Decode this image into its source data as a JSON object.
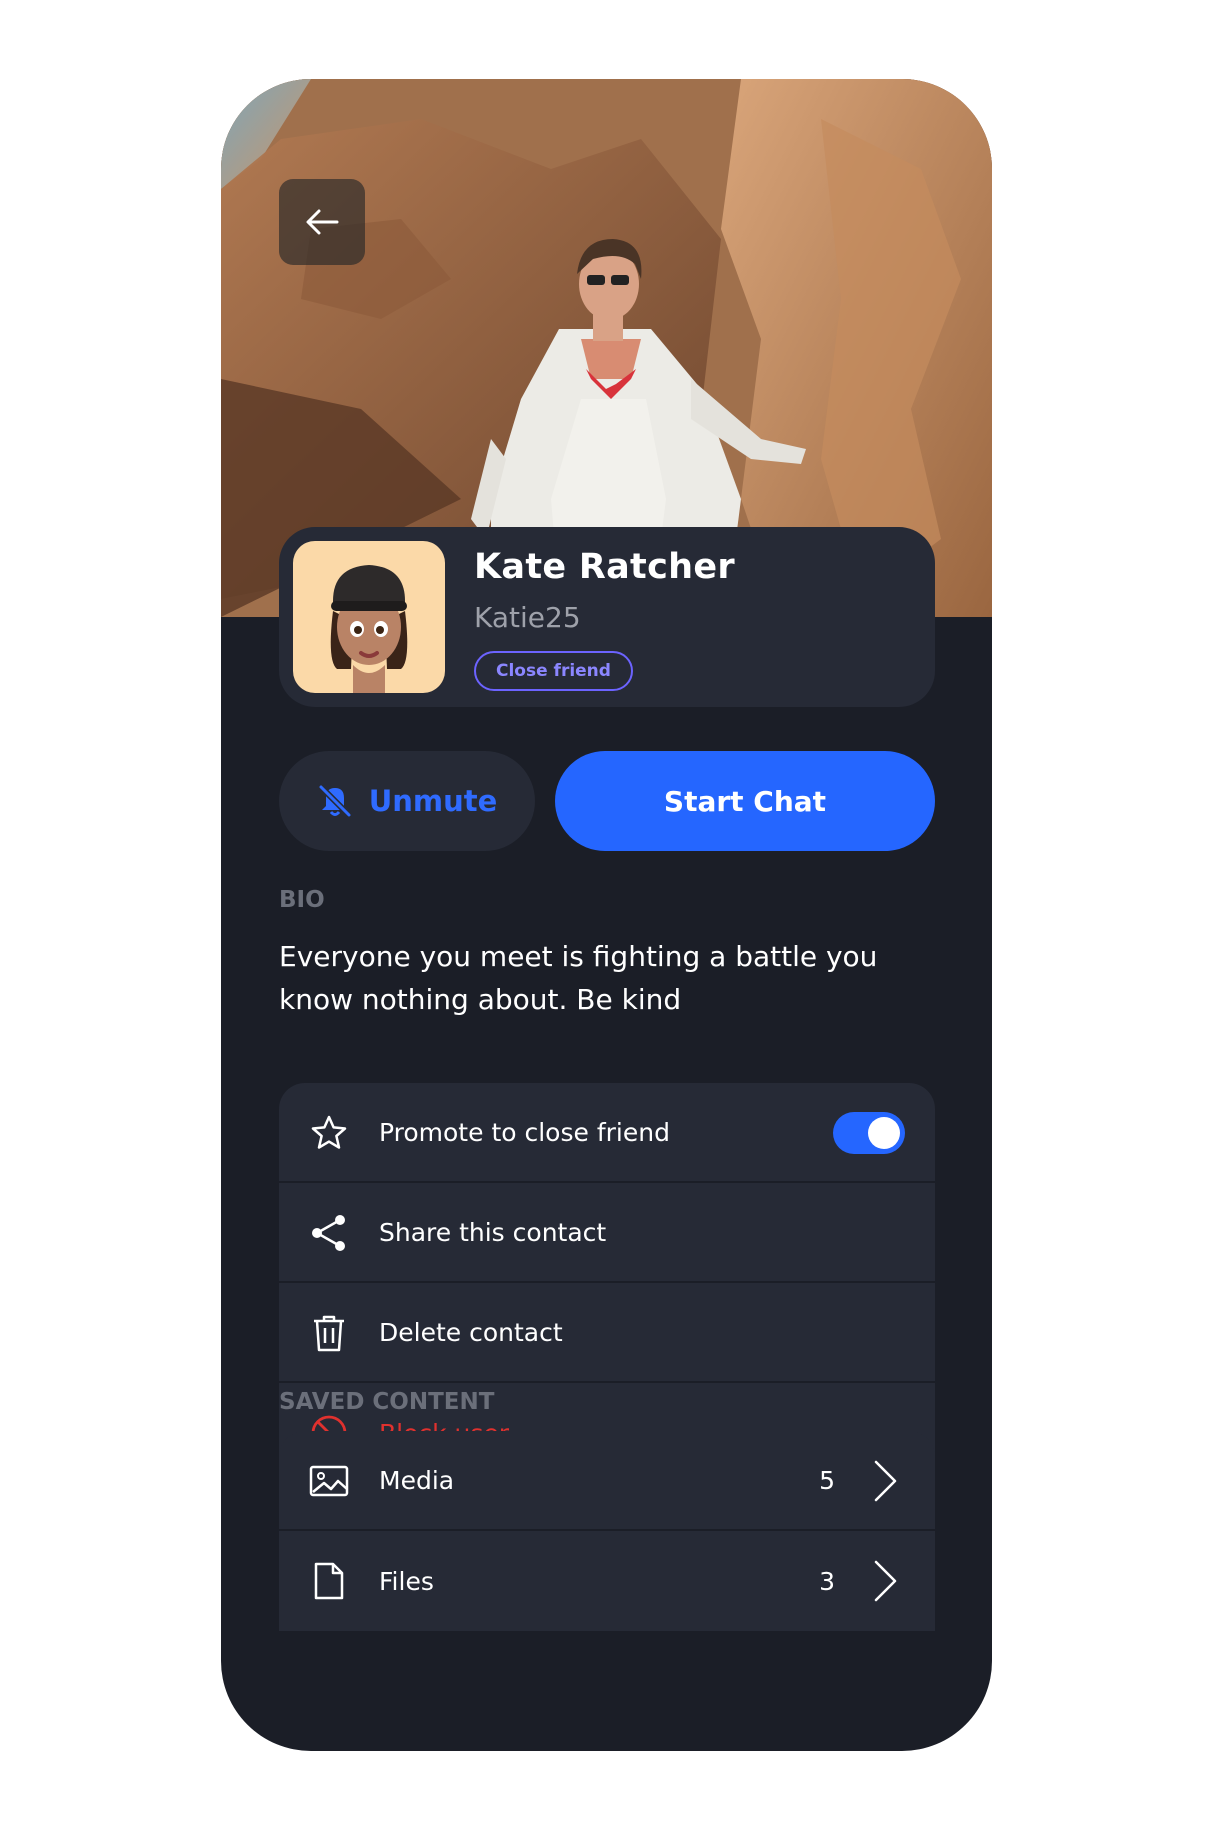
{
  "profile": {
    "name": "Kate Ratcher",
    "username": "Katie25",
    "badge": "Close friend"
  },
  "actions": {
    "unmute_label": "Unmute",
    "start_chat_label": "Start Chat"
  },
  "bio": {
    "label": "BIO",
    "text": "Everyone you meet is fighting a battle you know nothing about. Be kind"
  },
  "settings": {
    "promote_label": "Promote to close friend",
    "promote_enabled": true,
    "share_label": "Share this contact",
    "delete_label": "Delete contact",
    "block_label": "Block user"
  },
  "saved": {
    "label": "SAVED CONTENT",
    "items": [
      {
        "label": "Media",
        "count": "5",
        "icon": "image-icon"
      },
      {
        "label": "Files",
        "count": "3",
        "icon": "file-icon"
      }
    ]
  },
  "colors": {
    "background": "#1b1e27",
    "card": "#262a36",
    "accent": "#2566ff",
    "badge": "#6c63ff",
    "danger": "#e0312e"
  }
}
